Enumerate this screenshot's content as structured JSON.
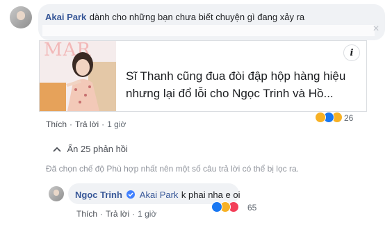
{
  "comment": {
    "author": "Akai Park",
    "text": "dành cho những bạn chưa biết chuyện gì đang xảy ra",
    "link_preview": {
      "title": "Sĩ Thanh cũng đua đòi đập hộp hàng hiệu nhưng lại đổ lỗi cho Ngọc Trinh và Hồ...",
      "thumbnail_text": "MAR",
      "info_icon": "i"
    },
    "reactions": {
      "icons": [
        "haha",
        "like",
        "sad"
      ],
      "count": "26"
    },
    "actions": {
      "like": "Thích",
      "reply": "Trả lời",
      "time": "1 giờ"
    }
  },
  "hide_replies": {
    "icon": "chevron-up-icon",
    "label": "Ẩn 25 phản hồi"
  },
  "filter_notice": "Đã chọn chế độ Phù hợp nhất nên một số câu trả lời có thể bị lọc ra.",
  "reply": {
    "author": "Ngọc Trinh",
    "verified": true,
    "mention": "Akai Park",
    "text": "k phai nha e oi",
    "reactions": {
      "icons": [
        "like",
        "haha",
        "love"
      ],
      "count": "65"
    },
    "actions": {
      "like": "Thích",
      "reply": "Trả lời",
      "time": "1 giờ"
    }
  },
  "colors": {
    "link": "#385898",
    "bubble": "#f0f2f5",
    "like": "#1877f2",
    "love": "#f33e58",
    "haha": "#f7b125"
  }
}
